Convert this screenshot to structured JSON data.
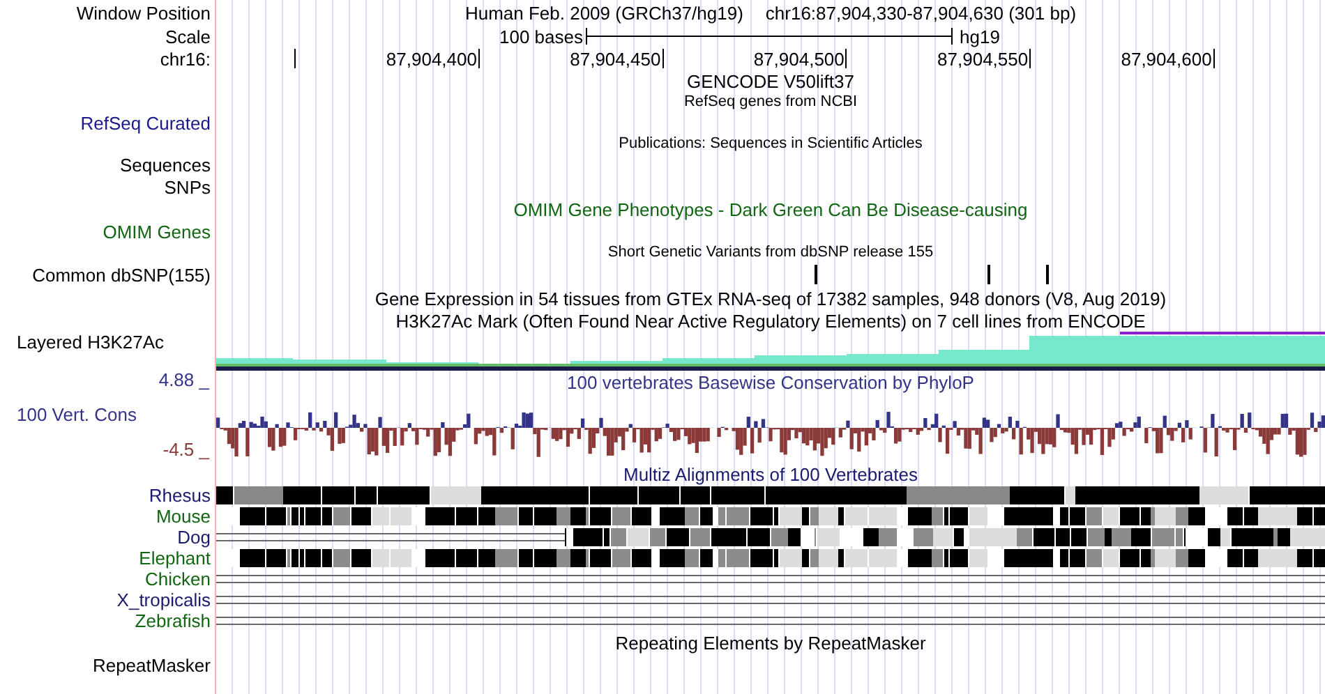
{
  "rows": [
    {
      "kind": "position",
      "label": "Window Position",
      "assembly": "Human Feb. 2009 (GRCh37/hg19)",
      "position": "chr16:87,904,330-87,904,630 (301 bp)"
    },
    {
      "kind": "scale",
      "label": "Scale",
      "span": "100 bases",
      "assembly": "hg19"
    },
    {
      "kind": "ruler",
      "label": "chr16:",
      "ticks": [
        "87,904,400",
        "87,904,450",
        "87,904,500",
        "87,904,550",
        "87,904,600"
      ]
    },
    {
      "kind": "title",
      "title": "GENCODE V50lift37",
      "color": "#000000"
    },
    {
      "kind": "subtitle",
      "title": "RefSeq genes from NCBI"
    },
    {
      "kind": "label",
      "label": "RefSeq Curated",
      "color": "#1a1a8c"
    },
    {
      "kind": "subtitle",
      "title": "Publications: Sequences in Scientific Articles"
    },
    {
      "kind": "label",
      "label": "Sequences",
      "color": "#000000"
    },
    {
      "kind": "label",
      "label": "SNPs",
      "color": "#000000"
    },
    {
      "kind": "title",
      "title": "OMIM Gene Phenotypes - Dark Green Can Be Disease-causing",
      "color": "#116611"
    },
    {
      "kind": "label",
      "label": "OMIM Genes",
      "color": "#116611"
    },
    {
      "kind": "subtitle",
      "title": "Short Genetic Variants from dbSNP release 155"
    },
    {
      "kind": "snps",
      "label": "Common dbSNP(155)"
    },
    {
      "kind": "title",
      "title": "Gene Expression in 54 tissues from GTEx RNA-seq of 17382 samples, 948 donors (V8, Aug 2019)",
      "color": "#000000"
    },
    {
      "kind": "title",
      "title": "H3K27Ac Mark (Often Found Near Active Regulatory Elements) on 7 cell lines from ENCODE",
      "color": "#000000"
    },
    {
      "kind": "histogram",
      "label": "Layered H3K27Ac"
    },
    {
      "kind": "wiggle",
      "label": "100 Vert. Cons",
      "title": "100 vertebrates Basewise Conservation by PhyloP",
      "max": "4.88 _",
      "min": "-4.5 _"
    },
    {
      "kind": "title",
      "title": "Multiz Alignments of 100 Vertebrates",
      "color": "#1a1a6e"
    },
    {
      "kind": "dense",
      "label": "Rhesus",
      "color": "#1a1a6e"
    },
    {
      "kind": "full",
      "label": "Mouse",
      "color": "#116611"
    },
    {
      "kind": "partial",
      "label": "Dog",
      "color": "#1a1a6e"
    },
    {
      "kind": "full",
      "label": "Elephant",
      "color": "#116611"
    },
    {
      "kind": "empty",
      "label": "Chicken",
      "color": "#116611"
    },
    {
      "kind": "empty",
      "label": "X_tropicalis",
      "color": "#1a1a6e"
    },
    {
      "kind": "empty",
      "label": "Zebrafish",
      "color": "#116611"
    },
    {
      "kind": "title",
      "title": "Repeating Elements by RepeatMasker",
      "color": "#000000"
    },
    {
      "kind": "label",
      "label": "RepeatMasker",
      "color": "#000000"
    }
  ]
}
